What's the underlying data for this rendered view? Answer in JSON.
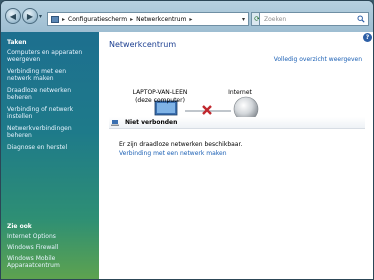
{
  "addressbar": {
    "breadcrumbs": [
      "Configuratiescherm",
      "Netwerkcentrum"
    ],
    "search_placeholder": "Zoeken"
  },
  "sidebar": {
    "tasks_heading": "Taken",
    "tasks": [
      "Computers en apparaten weergeven",
      "Verbinding met een netwerk maken",
      "Draadloze netwerken beheren",
      "Verbinding of netwerk instellen",
      "Netwerkverbindingen beheren",
      "Diagnose en herstel"
    ],
    "see_also_heading": "Zie ook",
    "see_also": [
      "Internet Options",
      "Windows Firewall",
      "Windows Mobile Apparaatcentrum"
    ]
  },
  "main": {
    "title": "Netwerkcentrum",
    "overview_link": "Volledig overzicht weergeven",
    "computer_name": "LAPTOP-VAN-LEEN",
    "computer_sub": "(deze computer)",
    "internet_label": "Internet",
    "section_title": "Niet verbonden",
    "status_text": "Er zijn draadloze netwerken beschikbaar.",
    "connect_link": "Verbinding met een netwerk maken"
  },
  "colors": {
    "title_blue": "#1c3f91",
    "link_blue": "#1a5fb4",
    "disconnect_red": "#c0272d"
  }
}
